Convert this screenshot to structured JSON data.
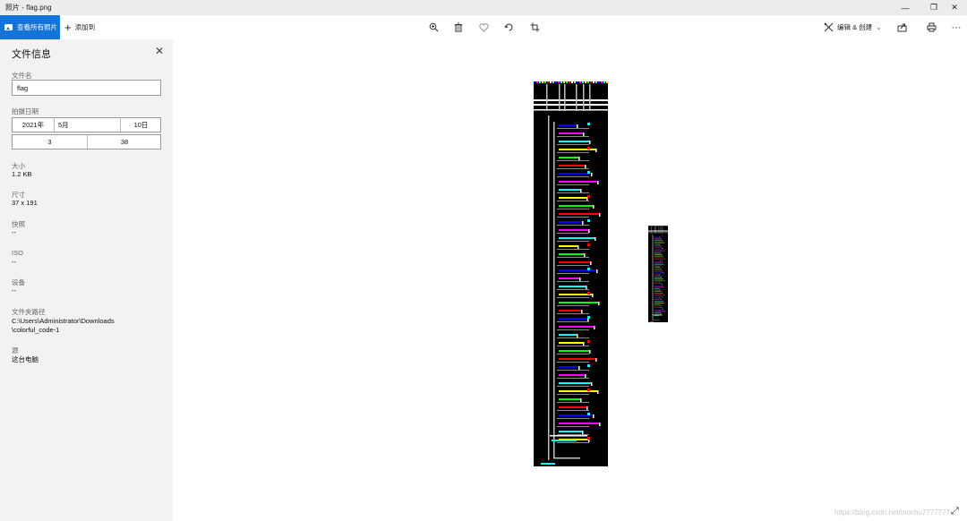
{
  "window": {
    "title": "照片 - flag.png",
    "controls": [
      "—",
      "❐",
      "✕"
    ]
  },
  "toolbar": {
    "view_all_label": "查看所有照片",
    "add_to_label": "添加到",
    "edit_create_label": "编辑 & 创建",
    "icons": {
      "zoom": "🔍",
      "delete": "🗑",
      "favorite": "♡",
      "rotate": "↻",
      "crop": "⌗",
      "share": "⇪",
      "print": "⎙",
      "more": "···"
    }
  },
  "info_panel": {
    "title": "文件信息",
    "close": "✕",
    "filename_label": "文件名",
    "filename_value": "flag",
    "date_label": "拍摄日期",
    "date_year": "2021年",
    "date_month": "5月",
    "date_day": "10日",
    "time_hour": "3",
    "time_minute": "38",
    "size_label": "大小",
    "size_value": "1.2 KB",
    "dimensions_label": "尺寸",
    "dimensions_value": "37 x 191",
    "shutter_label": "快照",
    "shutter_value": "--",
    "iso_label": "ISO",
    "iso_value": "--",
    "device_label": "设备",
    "device_value": "--",
    "folder_label": "文件夹路径",
    "folder_line1": "C:\\Users\\Administrator\\Downloads",
    "folder_line2": "\\colorful_code-1",
    "source_label": "源",
    "source_value": "这台电脑"
  },
  "viewer": {
    "watermark": "https://blog.csdn.net/mochu7777777",
    "expand_icon": "⤢"
  }
}
